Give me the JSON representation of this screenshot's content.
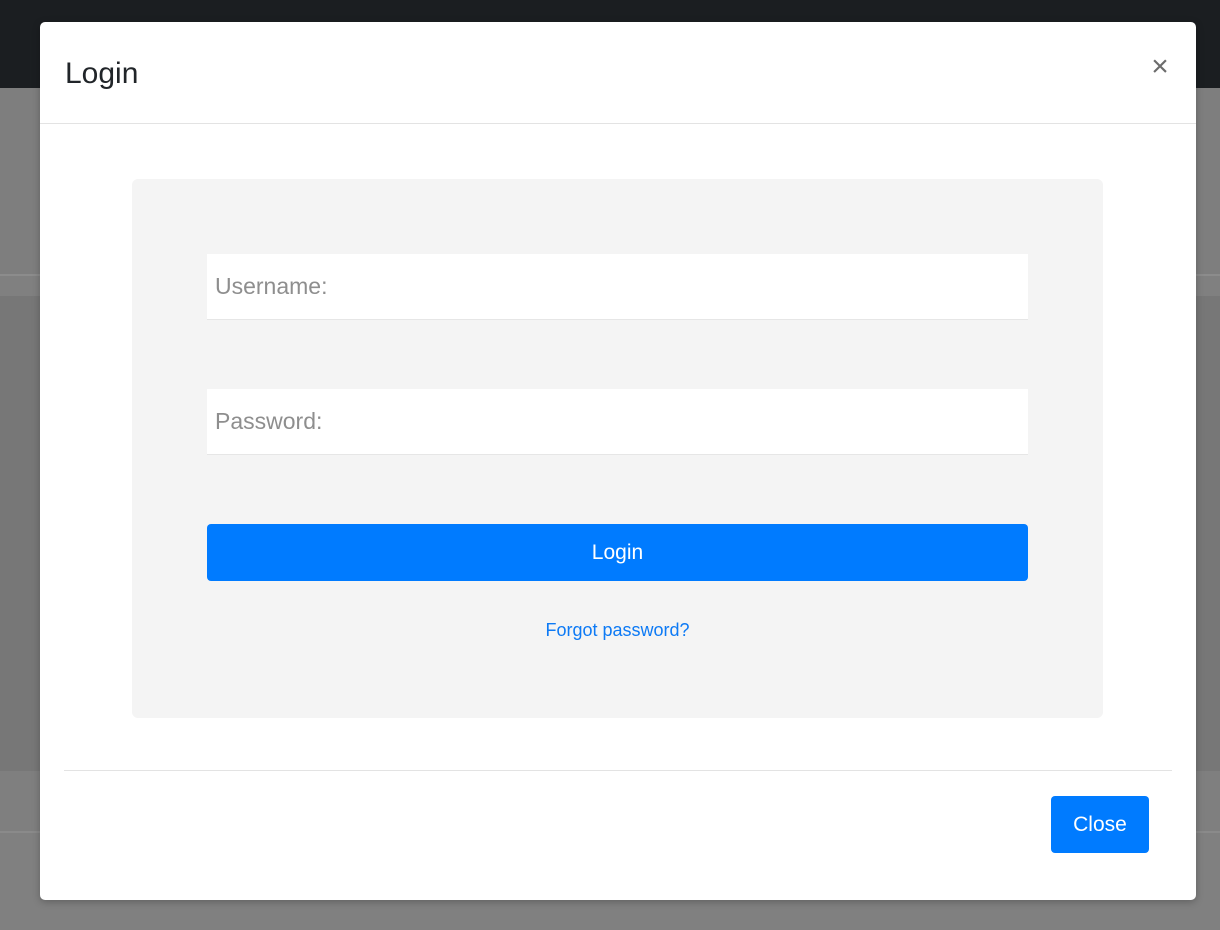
{
  "modal": {
    "title": "Login",
    "close_icon_glyph": "×",
    "close_icon": "close-icon"
  },
  "form": {
    "username": {
      "value": "",
      "placeholder": "Username:"
    },
    "password": {
      "value": "",
      "placeholder": "Password:"
    },
    "login_label": "Login",
    "forgot_label": "Forgot password?"
  },
  "footer": {
    "close_label": "Close"
  },
  "colors": {
    "primary": "#007bff",
    "link": "#0d7af5",
    "navbar": "#1b1e21",
    "backdrop": "#808080",
    "panel": "#f4f4f4"
  }
}
